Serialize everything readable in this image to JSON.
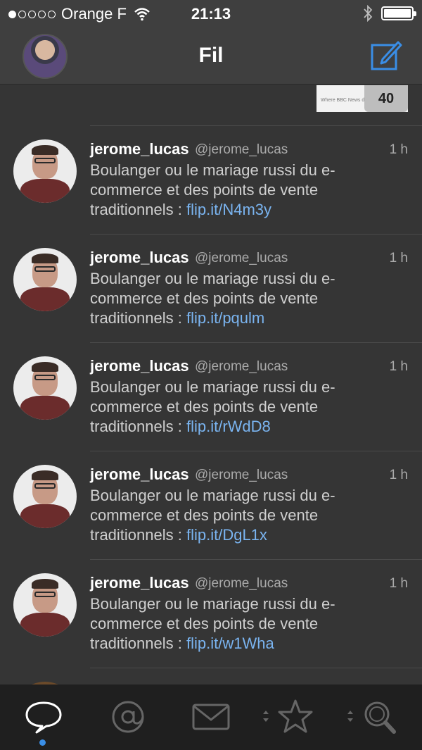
{
  "status_bar": {
    "carrier": "Orange F",
    "time": "21:13"
  },
  "nav": {
    "title": "Fil"
  },
  "top_thumb": {
    "badge": "40",
    "caption": "Where BBC News de... responsive"
  },
  "tweets": [
    {
      "name": "jerome_lucas",
      "handle": "@jerome_lucas",
      "time": "1 h",
      "text": "Boulanger ou le mariage russi du e-commerce et des points de vente traditionnels : ",
      "link": "flip.it/N4m3y"
    },
    {
      "name": "jerome_lucas",
      "handle": "@jerome_lucas",
      "time": "1 h",
      "text": "Boulanger ou le mariage russi du e-commerce et des points de vente traditionnels : ",
      "link": "flip.it/pqulm"
    },
    {
      "name": "jerome_lucas",
      "handle": "@jerome_lucas",
      "time": "1 h",
      "text": "Boulanger ou le mariage russi du e-commerce et des points de vente traditionnels : ",
      "link": "flip.it/rWdD8"
    },
    {
      "name": "jerome_lucas",
      "handle": "@jerome_lucas",
      "time": "1 h",
      "text": "Boulanger ou le mariage russi du e-commerce et des points de vente traditionnels : ",
      "link": "flip.it/DgL1x"
    },
    {
      "name": "jerome_lucas",
      "handle": "@jerome_lucas",
      "time": "1 h",
      "text": "Boulanger ou le mariage russi du e-commerce et des points de vente traditionnels : ",
      "link": "flip.it/w1Wha"
    }
  ],
  "tab_bar": {
    "tabs": [
      "speech-bubble-icon",
      "at-icon",
      "envelope-icon",
      "star-icon",
      "search-icon"
    ],
    "active_tab": "speech-bubble-icon",
    "accent": "#3a8ee6"
  },
  "colors": {
    "background": "#353535",
    "link": "#7ab4f0",
    "compose_icon": "#3a8ee6"
  }
}
